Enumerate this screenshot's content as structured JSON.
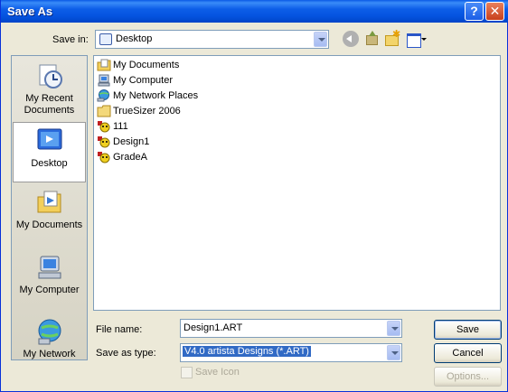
{
  "window": {
    "title": "Save As",
    "help_glyph": "?",
    "close_glyph": "✕"
  },
  "toolbar": {
    "save_in_label": "Save in:",
    "save_in_value": "Desktop",
    "icons": [
      "back-icon",
      "up-folder-icon",
      "new-folder-icon",
      "views-menu-icon"
    ]
  },
  "places": [
    {
      "label": "My Recent Documents",
      "icon": "recent-documents-icon",
      "selected": false
    },
    {
      "label": "Desktop",
      "icon": "desktop-icon",
      "selected": true
    },
    {
      "label": "My Documents",
      "icon": "my-documents-icon",
      "selected": false
    },
    {
      "label": "My Computer",
      "icon": "my-computer-icon",
      "selected": false
    },
    {
      "label": "My Network",
      "icon": "my-network-icon",
      "selected": false
    }
  ],
  "files": [
    {
      "name": "My Documents",
      "icon": "my-documents-icon"
    },
    {
      "name": "My Computer",
      "icon": "my-computer-icon"
    },
    {
      "name": "My Network Places",
      "icon": "network-places-icon"
    },
    {
      "name": "TrueSizer 2006",
      "icon": "folder-icon"
    },
    {
      "name": "111",
      "icon": "design-file-icon"
    },
    {
      "name": "Design1",
      "icon": "design-file-icon"
    },
    {
      "name": "GradeA",
      "icon": "design-file-icon"
    }
  ],
  "form": {
    "file_name_label": "File name:",
    "file_name_value": "Design1.ART",
    "save_type_label": "Save as type:",
    "save_type_value": "V4.0 artista Designs (*.ART)",
    "save_icon_label": "Save Icon"
  },
  "buttons": {
    "save": "Save",
    "cancel": "Cancel",
    "options": "Options..."
  }
}
